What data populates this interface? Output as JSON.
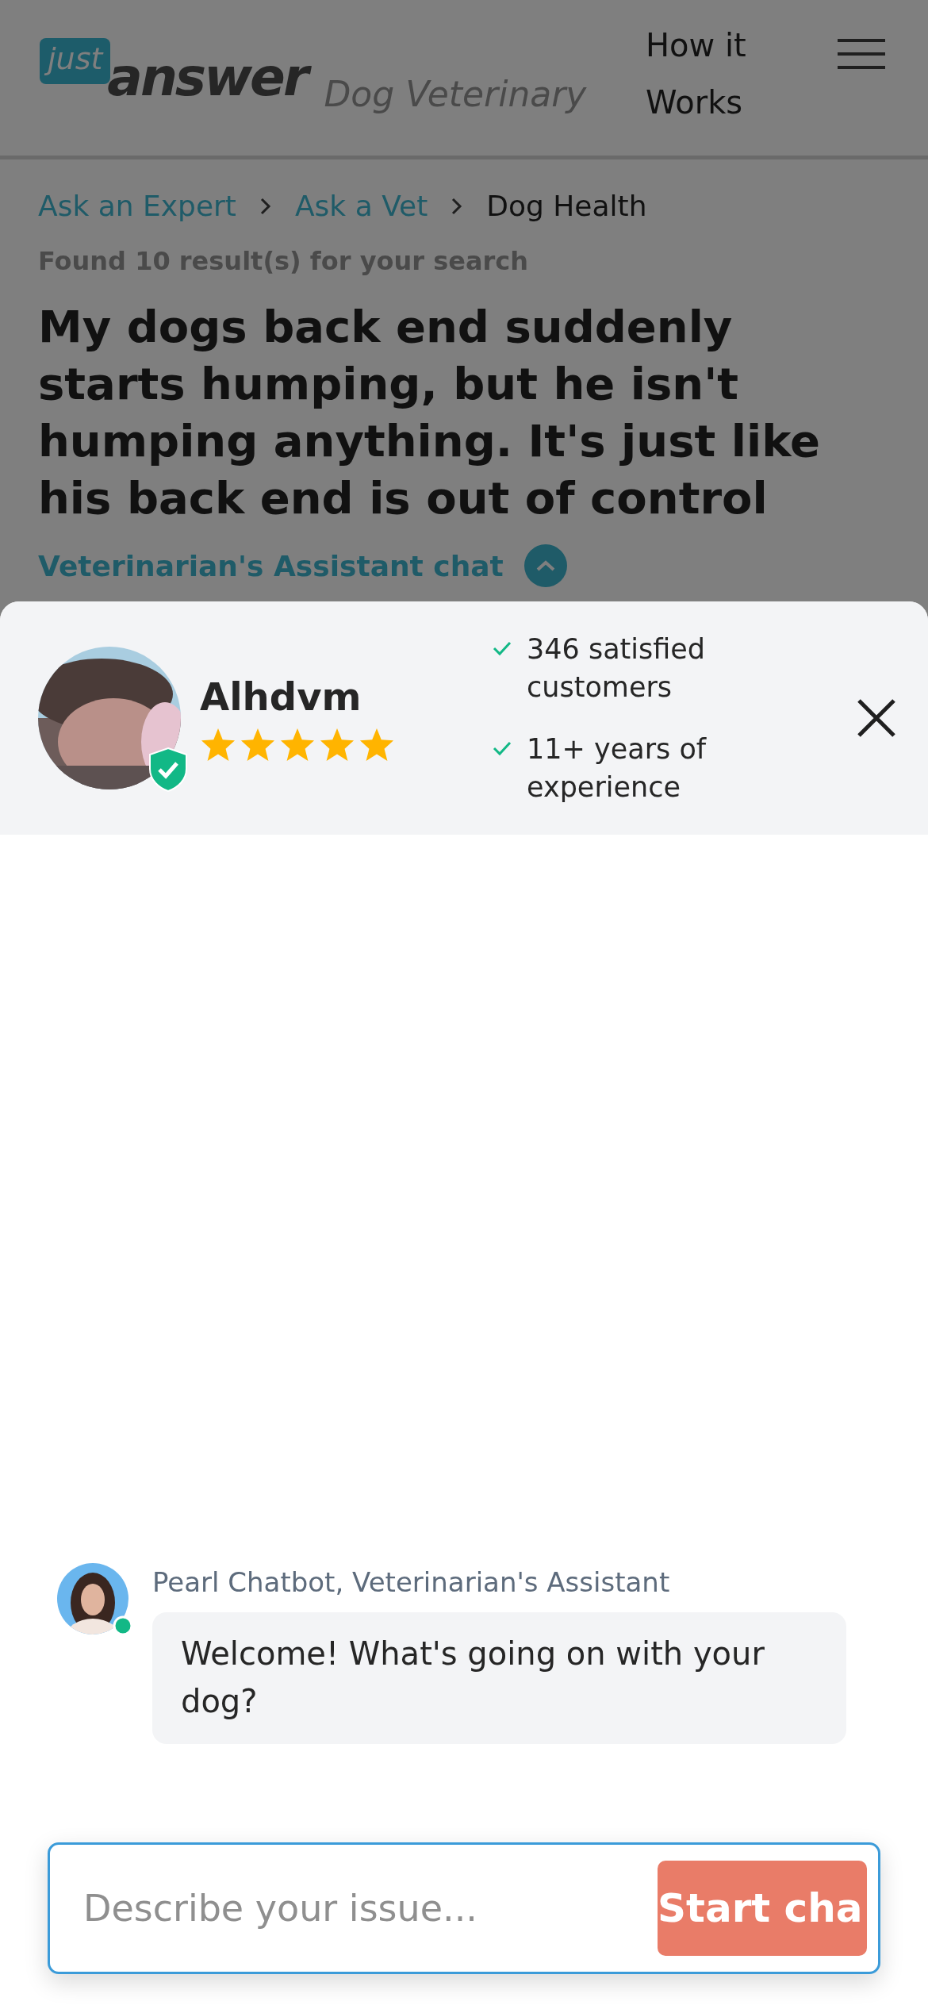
{
  "header": {
    "logo": {
      "top": "just",
      "bottom": "answer"
    },
    "category": "Dog Veterinary",
    "nav_link": "How it Works"
  },
  "breadcrumbs": [
    {
      "label": "Ask an Expert",
      "kind": "link"
    },
    {
      "label": "Ask a Vet",
      "kind": "link"
    },
    {
      "label": "Dog Health",
      "kind": "current"
    }
  ],
  "results_note": "Found 10 result(s) for your search",
  "question_title": "My dogs back end suddenly starts humping, but he isn't humping anything. It's just like his back end is out of control",
  "chat_toggle": {
    "label": "Veterinarian's Assistant chat"
  },
  "expert": {
    "name": "Alhdvm",
    "stars": 5,
    "verified": true,
    "facts": [
      "346 satisfied customers",
      "11+ years of experience"
    ]
  },
  "chat": {
    "sender": "Pearl Chatbot, Veterinarian's Assistant",
    "online": true,
    "message": "Welcome! What's going on with your dog?"
  },
  "composer": {
    "placeholder": "Describe your issue...",
    "button": "Start cha"
  }
}
